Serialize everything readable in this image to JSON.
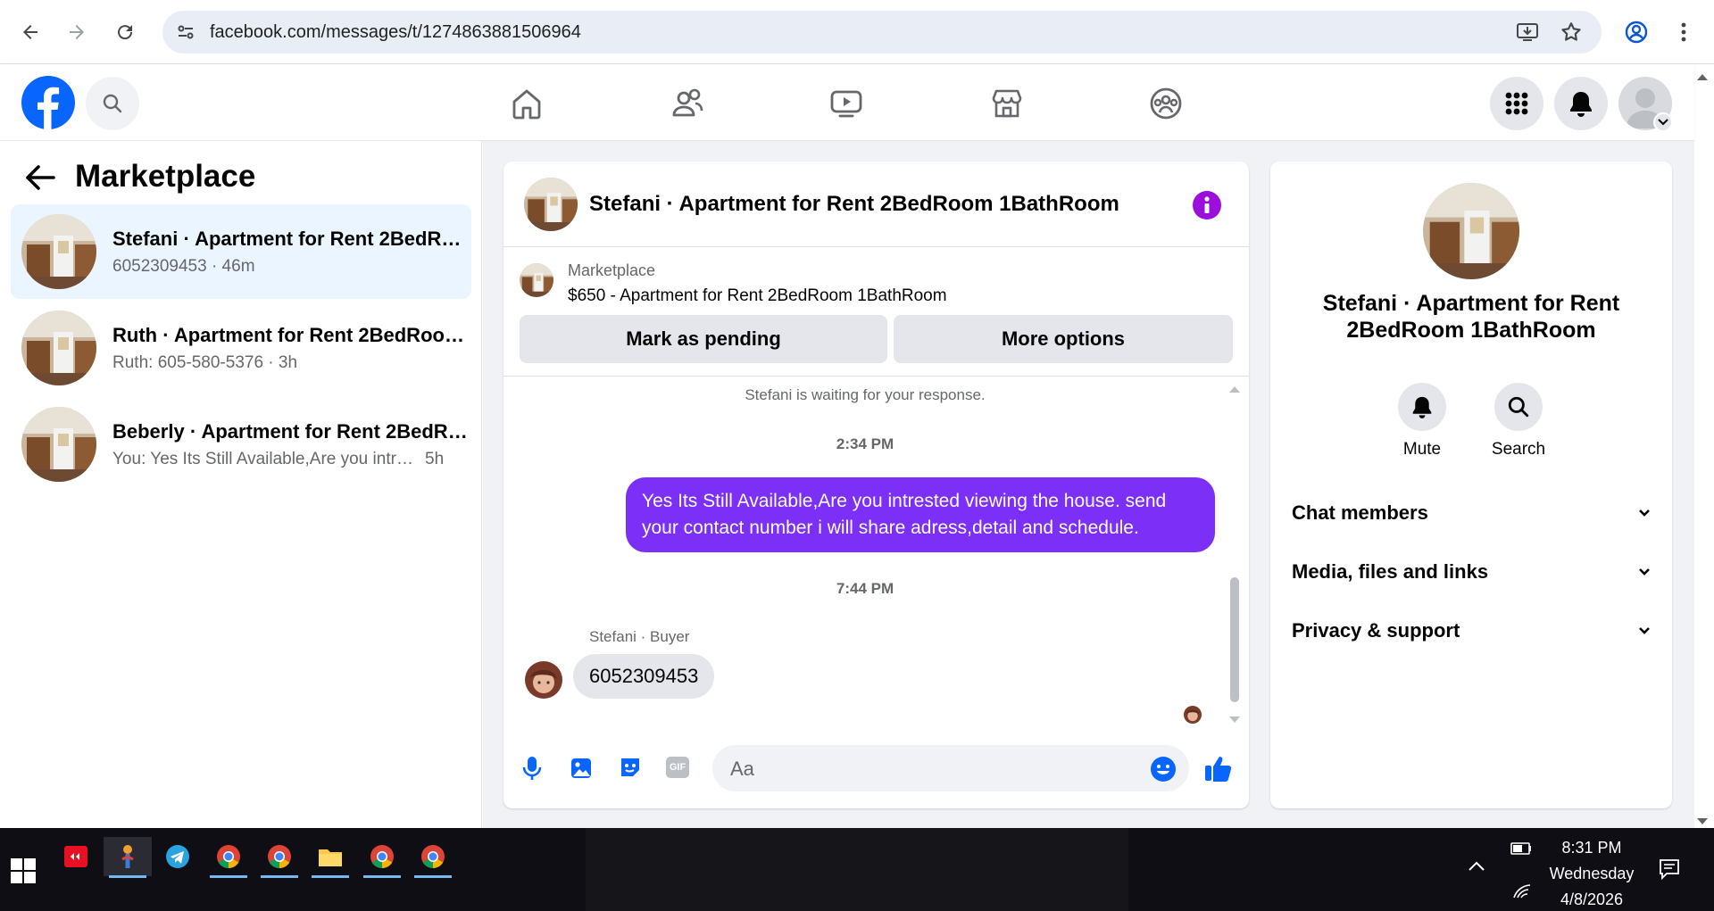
{
  "browser": {
    "url": "facebook.com/messages/t/1274863881506964",
    "icons": [
      "back-arrow-icon",
      "forward-arrow-icon",
      "reload-icon",
      "site-settings-icon",
      "install-app-icon",
      "bookmark-star-icon",
      "profile-icon",
      "more-vert-icon"
    ]
  },
  "fb": {
    "nav_icons": [
      "home-icon",
      "friends-icon",
      "video-icon",
      "marketplace-icon",
      "groups-icon"
    ],
    "right_icons": [
      "menu-grid-icon",
      "notifications-icon",
      "account-avatar"
    ]
  },
  "left": {
    "title": "Marketplace",
    "conversations": [
      {
        "name": "Stefani · Apartment for Rent 2BedRoom 1BathRoom",
        "sub": "6052309453 · 46m",
        "active": true
      },
      {
        "name": "Ruth · Apartment for Rent 2BedRoom 1BathRoom",
        "sub": "Ruth: 605-580-5376 · 3h",
        "active": false
      },
      {
        "name": "Beberly · Apartment for Rent 2BedRoom 1BathRoom",
        "sub": "You: Yes Its Still Available,Are you intre...",
        "time": "5h",
        "active": false
      }
    ]
  },
  "chat": {
    "title": "Stefani · Apartment for Rent 2BedRoom 1BathRoom",
    "listing_label": "Marketplace",
    "listing_title": "$650 - Apartment for Rent 2BedRoom 1BathRoom",
    "mark_pending": "Mark as pending",
    "more_options": "More options",
    "waiting": "Stefani is waiting for your response.",
    "time1": "2:34 PM",
    "outgoing": "Yes Its Still Available,Are you intrested viewing the house. send your contact number i will share adress,detail and schedule.",
    "time2": "7:44 PM",
    "sender": "Stefani · Buyer",
    "incoming": "6052309453",
    "composer_placeholder": "Aa",
    "accent": "#7b2ff7"
  },
  "info": {
    "name": "Stefani · Apartment for Rent 2BedRoom 1BathRoom",
    "mute": "Mute",
    "search": "Search",
    "sections": [
      "Chat members",
      "Media, files and links",
      "Privacy & support"
    ]
  },
  "taskbar": {
    "time": "8:31 PM",
    "day": "Wednesday",
    "date": "4/8/2026"
  }
}
